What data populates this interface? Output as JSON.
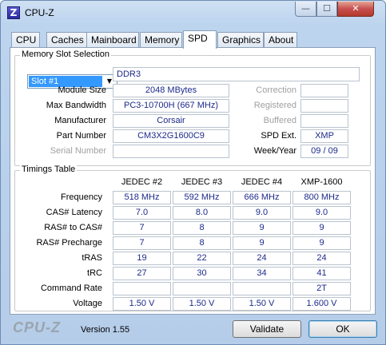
{
  "window": {
    "title": "CPU-Z",
    "icon_letter": "Z",
    "min_glyph": "—",
    "max_glyph": "☐",
    "close_glyph": "✕"
  },
  "tabs": [
    "CPU",
    "Caches",
    "Mainboard",
    "Memory",
    "SPD",
    "Graphics",
    "About"
  ],
  "memory_slot": {
    "group_label": "Memory Slot Selection",
    "slot_selected": "Slot #1",
    "type": "DDR3",
    "module_size_label": "Module Size",
    "module_size": "2048 MBytes",
    "max_bandwidth_label": "Max Bandwidth",
    "max_bandwidth": "PC3-10700H (667 MHz)",
    "manufacturer_label": "Manufacturer",
    "manufacturer": "Corsair",
    "part_number_label": "Part Number",
    "part_number": "CM3X2G1600C9",
    "serial_number_label": "Serial Number",
    "serial_number": "",
    "correction_label": "Correction",
    "correction": "",
    "registered_label": "Registered",
    "registered": "",
    "buffered_label": "Buffered",
    "buffered": "",
    "spd_ext_label": "SPD Ext.",
    "spd_ext": "XMP",
    "week_year_label": "Week/Year",
    "week_year": "09 / 09"
  },
  "timings": {
    "group_label": "Timings Table",
    "columns": [
      "JEDEC #2",
      "JEDEC #3",
      "JEDEC #4",
      "XMP-1600"
    ],
    "rows": [
      {
        "label": "Frequency",
        "values": [
          "518 MHz",
          "592 MHz",
          "666 MHz",
          "800 MHz"
        ]
      },
      {
        "label": "CAS# Latency",
        "values": [
          "7.0",
          "8.0",
          "9.0",
          "9.0"
        ]
      },
      {
        "label": "RAS# to CAS#",
        "values": [
          "7",
          "8",
          "9",
          "9"
        ]
      },
      {
        "label": "RAS# Precharge",
        "values": [
          "7",
          "8",
          "9",
          "9"
        ]
      },
      {
        "label": "tRAS",
        "values": [
          "19",
          "22",
          "24",
          "24"
        ]
      },
      {
        "label": "tRC",
        "values": [
          "27",
          "30",
          "34",
          "41"
        ]
      },
      {
        "label": "Command Rate",
        "values": [
          "",
          "",
          "",
          "2T"
        ]
      },
      {
        "label": "Voltage",
        "values": [
          "1.50 V",
          "1.50 V",
          "1.50 V",
          "1.600 V"
        ]
      }
    ]
  },
  "footer": {
    "brand": "CPU-Z",
    "version": "Version 1.55",
    "validate": "Validate",
    "ok": "OK"
  }
}
